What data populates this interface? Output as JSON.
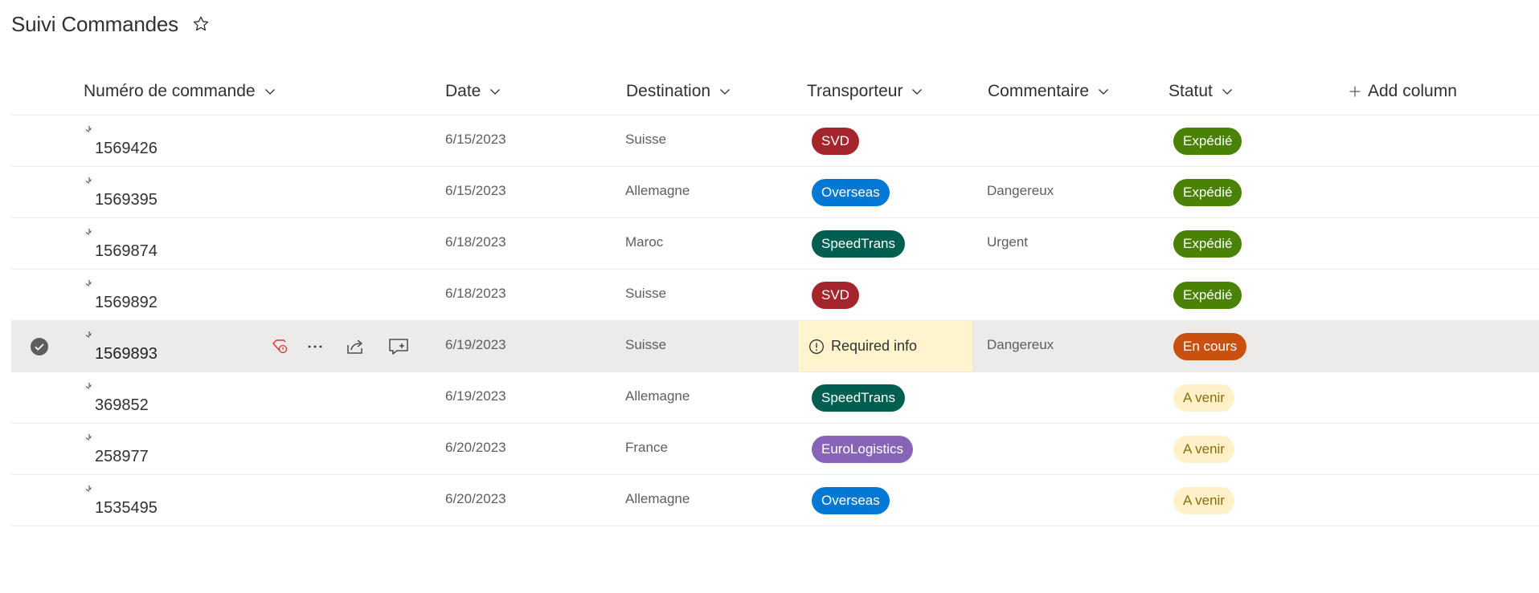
{
  "title": "Suivi Commandes",
  "columns": {
    "order": "Numéro de commande",
    "date": "Date",
    "destination": "Destination",
    "carrier": "Transporteur",
    "comment": "Commentaire",
    "status": "Statut",
    "add": "Add column"
  },
  "required_info": "Required info",
  "rows": [
    {
      "order": "1569426",
      "date": "6/15/2023",
      "destination": "Suisse",
      "carrier": "SVD",
      "comment": "",
      "status": "Expédié"
    },
    {
      "order": "1569395",
      "date": "6/15/2023",
      "destination": "Allemagne",
      "carrier": "Overseas",
      "comment": "Dangereux",
      "status": "Expédié"
    },
    {
      "order": "1569874",
      "date": "6/18/2023",
      "destination": "Maroc",
      "carrier": "SpeedTrans",
      "comment": "Urgent",
      "status": "Expédié"
    },
    {
      "order": "1569892",
      "date": "6/18/2023",
      "destination": "Suisse",
      "carrier": "SVD",
      "comment": "",
      "status": "Expédié"
    },
    {
      "order": "1569893",
      "date": "6/19/2023",
      "destination": "Suisse",
      "carrier": "",
      "comment": "Dangereux",
      "status": "En cours"
    },
    {
      "order": "369852",
      "date": "6/19/2023",
      "destination": "Allemagne",
      "carrier": "SpeedTrans",
      "comment": "",
      "status": "A venir"
    },
    {
      "order": "258977",
      "date": "6/20/2023",
      "destination": "France",
      "carrier": "EuroLogistics",
      "comment": "",
      "status": "A venir"
    },
    {
      "order": "1535495",
      "date": "6/20/2023",
      "destination": "Allemagne",
      "carrier": "Overseas",
      "comment": "",
      "status": "A venir"
    }
  ],
  "colors": {
    "carrier_svd": "#a4262c",
    "carrier_overseas": "#0078d4",
    "carrier_speedtrans": "#005e50",
    "carrier_eurologistics": "#8764b8",
    "status_expedie": "#498205",
    "status_en_cours": "#ca5010",
    "status_a_venir_bg": "#fff1c7",
    "status_a_venir_text": "#8a6a13",
    "required_bg": "#fff4ce",
    "selected_row_bg": "#edebe9"
  }
}
